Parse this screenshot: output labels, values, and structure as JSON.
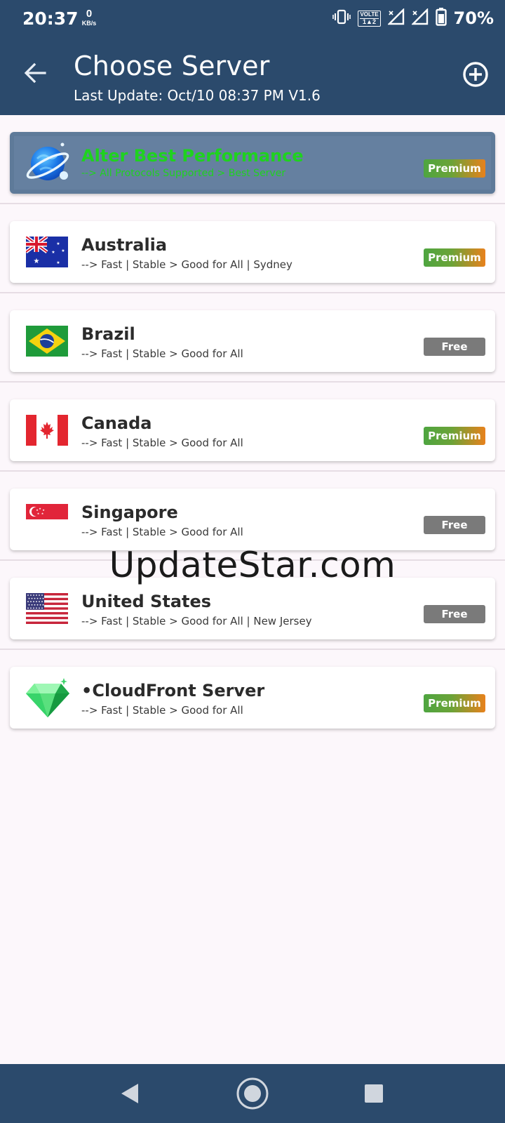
{
  "status_bar": {
    "time": "20:37",
    "net_speed_value": "0",
    "net_speed_unit": "KB/s",
    "volte_line1": "VOLTE",
    "volte_line2": "1▲2",
    "battery_percent": "70%",
    "icons": [
      "vibrate-icon",
      "volte-icon",
      "signal-sim1-icon",
      "signal-sim2-icon",
      "battery-icon"
    ]
  },
  "app_bar": {
    "title": "Choose Server",
    "subtitle": "Last Update: Oct/10 08:37 PM V1.6",
    "back_icon": "back-arrow-icon",
    "add_icon": "add-circle-icon"
  },
  "servers": [
    {
      "name": "Alter Best Performance",
      "desc": "--> All Protocols Supported > Best Server",
      "badge": "Premium",
      "tier": "premium",
      "icon": "planet-icon",
      "featured": true
    },
    {
      "name": "Australia",
      "desc": "--> Fast | Stable > Good for All | Sydney",
      "badge": "Premium",
      "tier": "premium",
      "icon": "australia-flag-icon"
    },
    {
      "name": "Brazil",
      "desc": "--> Fast | Stable > Good for All",
      "badge": "Free",
      "tier": "free",
      "icon": "brazil-flag-icon"
    },
    {
      "name": "Canada",
      "desc": "--> Fast | Stable > Good for All",
      "badge": "Premium",
      "tier": "premium",
      "icon": "canada-flag-icon"
    },
    {
      "name": "Singapore",
      "desc": "--> Fast | Stable > Good for All",
      "badge": "Free",
      "tier": "free",
      "icon": "singapore-flag-icon"
    },
    {
      "name": "United States",
      "desc": "--> Fast | Stable > Good for All | New Jersey",
      "badge": "Free",
      "tier": "free",
      "icon": "usa-flag-icon"
    },
    {
      "name": "•CloudFront Server",
      "desc": "--> Fast | Stable > Good for All",
      "badge": "Premium",
      "tier": "premium",
      "icon": "diamond-icon"
    }
  ],
  "watermark": "UpdateStar.com",
  "nav_bar": {
    "back_icon": "nav-back-icon",
    "home_icon": "nav-home-icon",
    "recents_icon": "nav-recents-icon"
  },
  "colors": {
    "bar": "#2b4a6c",
    "featured_text": "#1fd21f",
    "free_badge": "#7a7a7a",
    "premium_green": "#4ea540",
    "premium_orange": "#e8811c"
  }
}
